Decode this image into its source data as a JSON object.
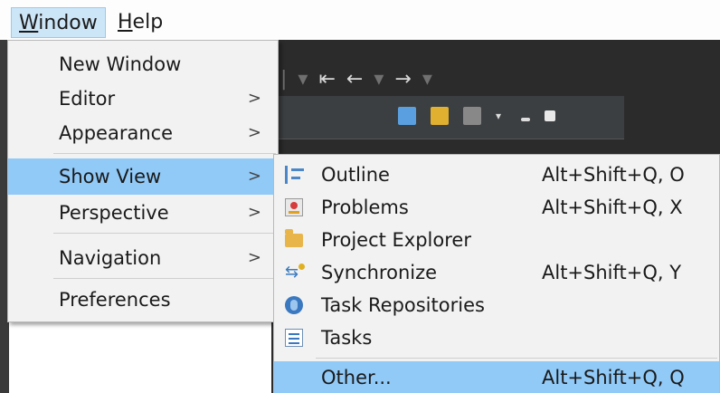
{
  "menubar": {
    "window": {
      "label": "Window",
      "mnemonic": "W",
      "rest": "indow"
    },
    "help": {
      "label": "Help",
      "mnemonic": "H",
      "rest": "elp"
    }
  },
  "window_menu": {
    "items": [
      {
        "label": "New Window",
        "has_submenu": false
      },
      {
        "label": "Editor",
        "has_submenu": true
      },
      {
        "label": "Appearance",
        "has_submenu": true
      },
      {
        "label": "Show View",
        "has_submenu": true,
        "active": true
      },
      {
        "label": "Perspective",
        "has_submenu": true
      },
      {
        "label": "Navigation",
        "has_submenu": true
      },
      {
        "label": "Preferences",
        "has_submenu": false
      }
    ],
    "submenu_arrow": ">"
  },
  "show_view_menu": {
    "items": [
      {
        "label": "Outline",
        "shortcut": "Alt+Shift+Q, O",
        "icon": "outline-icon"
      },
      {
        "label": "Problems",
        "shortcut": "Alt+Shift+Q, X",
        "icon": "problems-icon"
      },
      {
        "label": "Project Explorer",
        "shortcut": "",
        "icon": "folder-icon"
      },
      {
        "label": "Synchronize",
        "shortcut": "Alt+Shift+Q, Y",
        "icon": "sync-icon"
      },
      {
        "label": "Task Repositories",
        "shortcut": "",
        "icon": "repo-icon"
      },
      {
        "label": "Tasks",
        "shortcut": "",
        "icon": "tasks-icon"
      },
      {
        "label": "Other...",
        "shortcut": "Alt+Shift+Q, Q",
        "active": true
      }
    ]
  },
  "colors": {
    "highlight": "#91c9f7",
    "menu_bg": "#f2f2f2",
    "ide_bg": "#2b2b2b"
  }
}
